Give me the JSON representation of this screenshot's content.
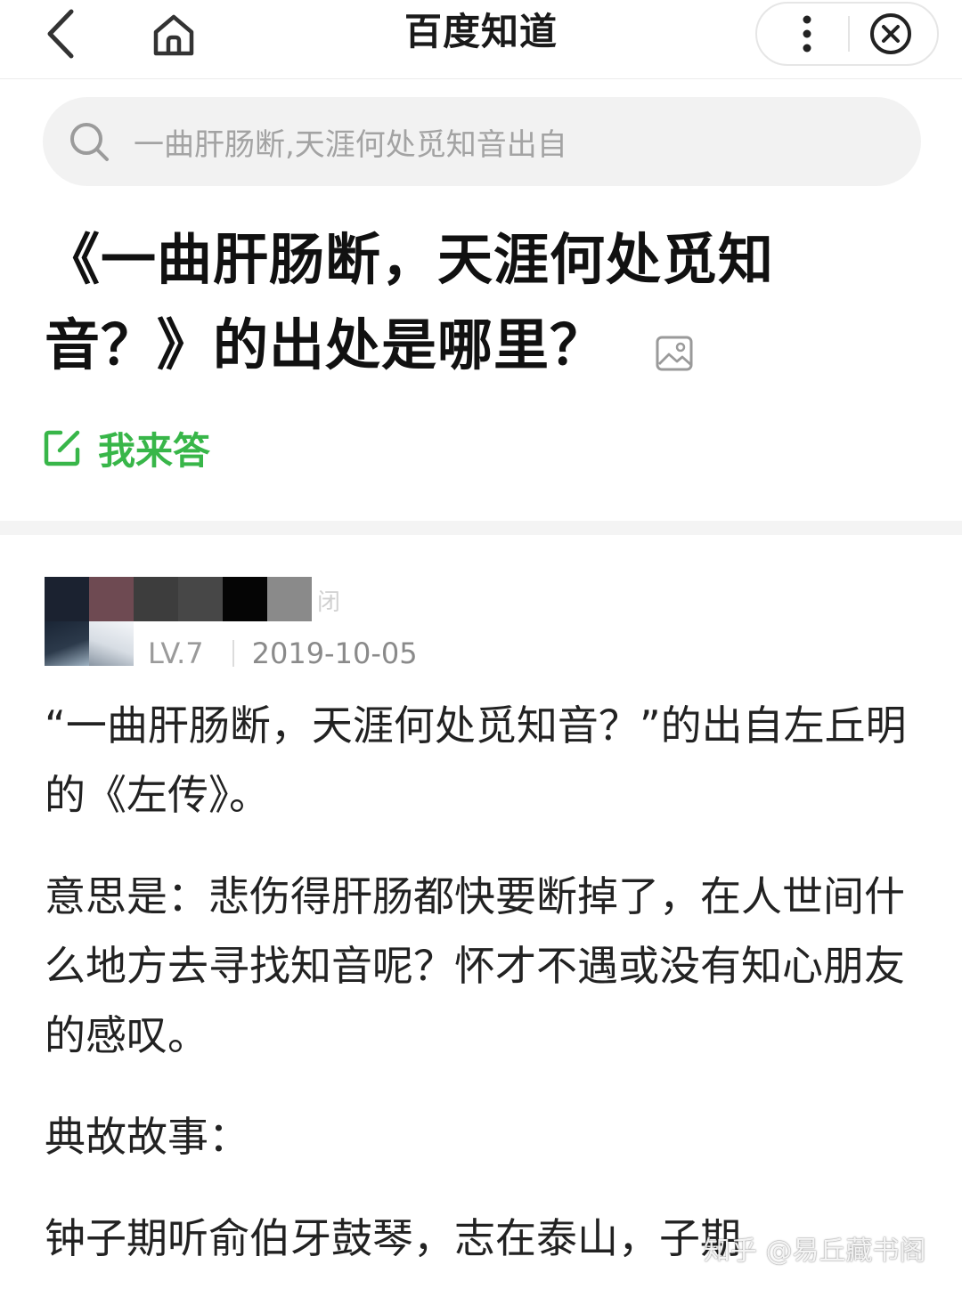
{
  "header": {
    "title": "百度知道",
    "icons": {
      "back": "chevron-left-icon",
      "home": "home-icon",
      "more": "more-vertical-icon",
      "close": "close-circle-icon"
    }
  },
  "search": {
    "placeholder": "一曲肝肠断,天涯何处觅知音出自",
    "icon": "search-icon"
  },
  "question": {
    "title": "《一曲肝肠断，天涯何处觅知音？》的出处是哪里？",
    "has_image_icon": true,
    "answer_button_label": "我来答",
    "accent_color": "#38b649"
  },
  "answer": {
    "author": {
      "name_tail": "闭",
      "level": "LV.7",
      "date": "2019-10-05"
    },
    "paragraphs": [
      "“一曲肝肠断，天涯何处觅知音？”的出自左丘明的《左传》。",
      "意思是：悲伤得肝肠都快要断掉了，在人世间什么地方去寻找知音呢？怀才不遇或没有知心朋友的感叹。",
      "典故故事：",
      "钟子期听俞伯牙鼓琴，志在泰山，子期"
    ]
  },
  "watermark": "知乎 @易丘藏书阁"
}
